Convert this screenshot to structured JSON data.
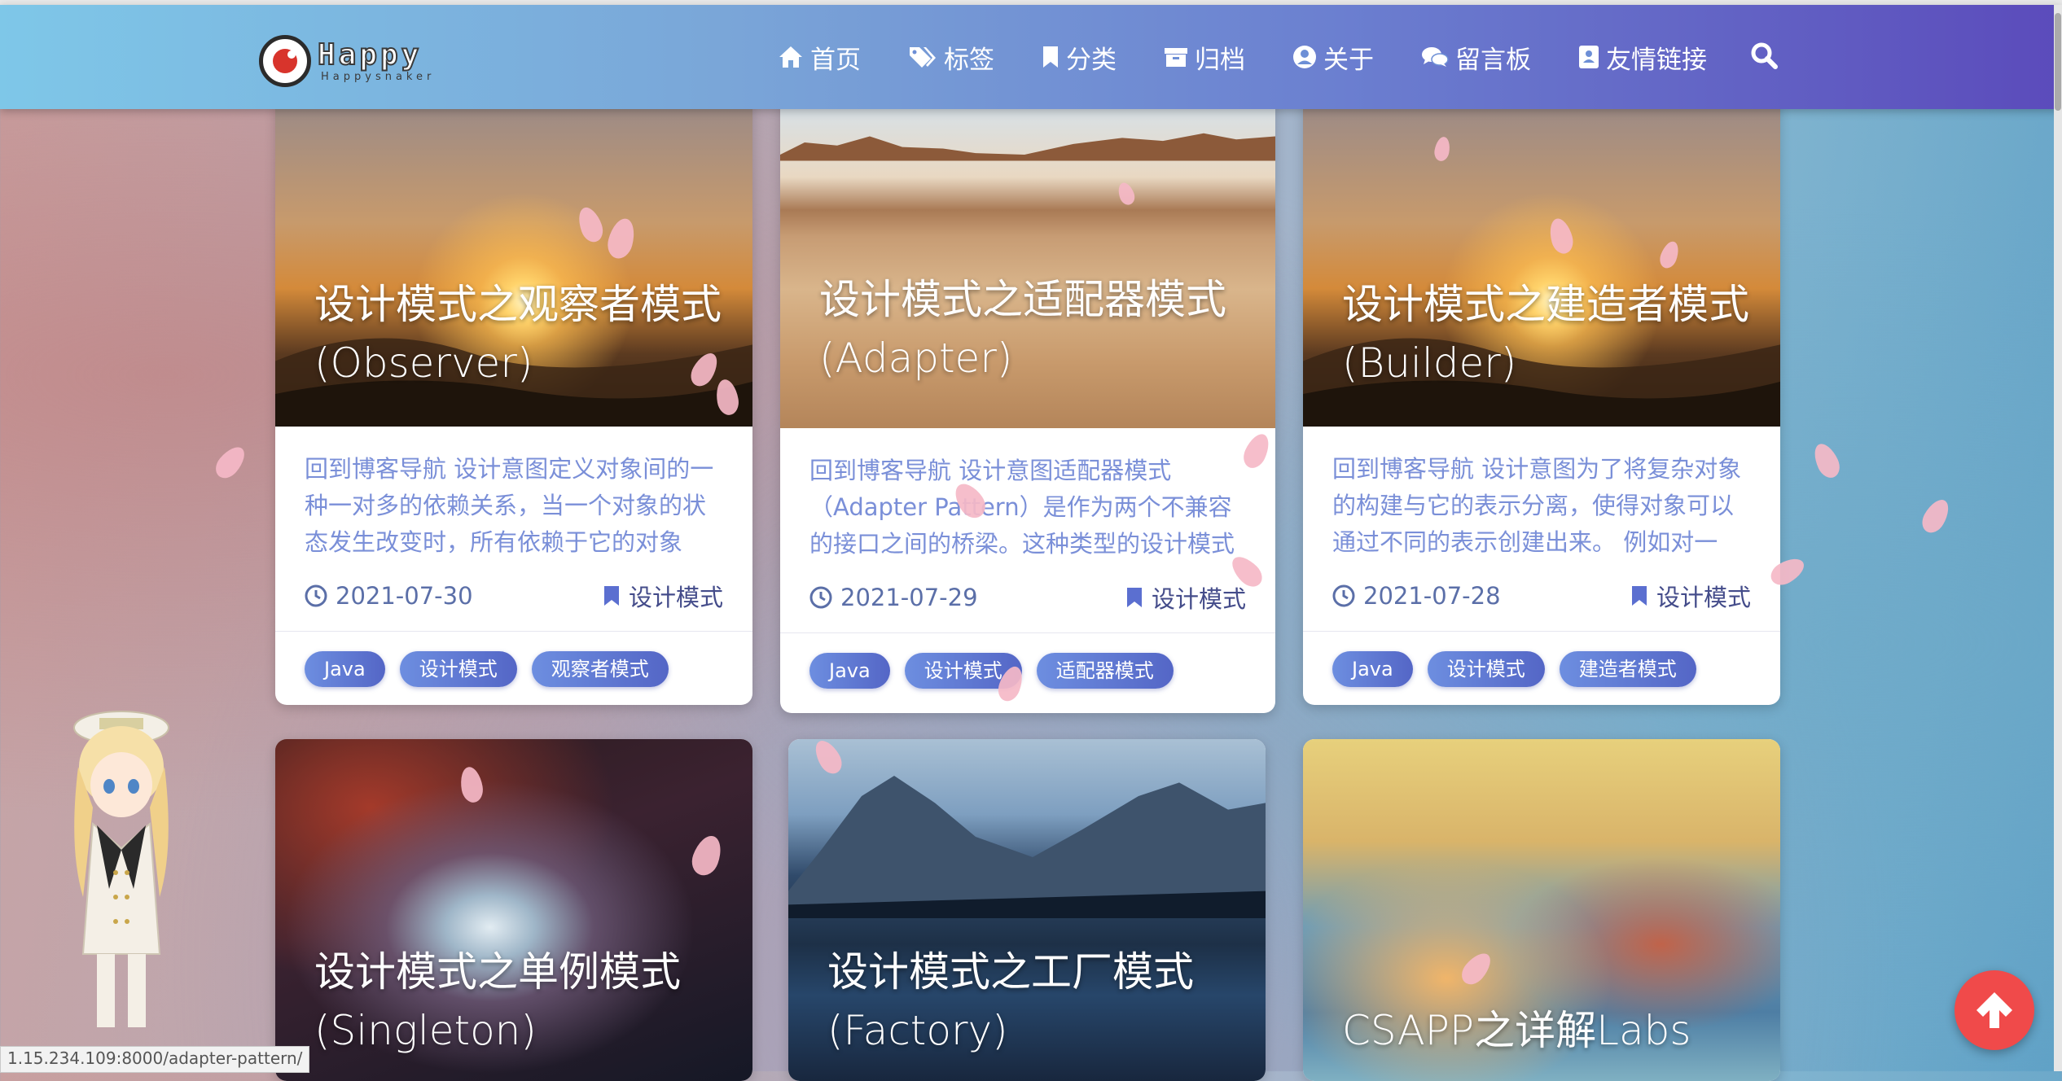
{
  "logo": {
    "main": "Happy",
    "sub": "Happysnaker"
  },
  "nav": [
    {
      "label": "首页",
      "icon": "home-icon"
    },
    {
      "label": "标签",
      "icon": "tags-icon"
    },
    {
      "label": "分类",
      "icon": "bookmark-icon"
    },
    {
      "label": "归档",
      "icon": "archive-icon"
    },
    {
      "label": "关于",
      "icon": "user-circle-icon"
    },
    {
      "label": "留言板",
      "icon": "comments-icon"
    },
    {
      "label": "友情链接",
      "icon": "address-card-icon"
    }
  ],
  "posts": [
    {
      "title": "设计模式之观察者模式",
      "subtitle": "(Observer)",
      "desc": "回到博客导航 设计意图定义对象间的一种一对多的依赖关系，当一个对象的状态发生改变时，所有依赖于它的对象都...",
      "date": "2021-07-30",
      "category": "设计模式",
      "tags": [
        "Java",
        "设计模式",
        "观察者模式"
      ]
    },
    {
      "title": "设计模式之适配器模式",
      "subtitle": "(Adapter)",
      "desc": "回到博客导航 设计意图适配器模式（Adapter Pattern）是作为两个不兼容的接口之间的桥梁。这种类型的设计模式属...",
      "date": "2021-07-29",
      "category": "设计模式",
      "tags": [
        "Java",
        "设计模式",
        "适配器模式"
      ]
    },
    {
      "title": "设计模式之建造者模式",
      "subtitle": "(Builder)",
      "desc": "回到博客导航 设计意图为了将复杂对象的构建与它的表示分离，使得对象可以通过不同的表示创建出来。 例如对一个...",
      "date": "2021-07-28",
      "category": "设计模式",
      "tags": [
        "Java",
        "设计模式",
        "建造者模式"
      ]
    },
    {
      "title": "设计模式之单例模式",
      "subtitle": "(Singleton)"
    },
    {
      "title": "设计模式之工厂模式",
      "subtitle": "(Factory)"
    },
    {
      "title": "CSAPP之详解Labs",
      "subtitle": ""
    }
  ],
  "status_url": "1.15.234.109:8000/adapter-pattern/",
  "colors": {
    "accent": "#5b6fd0",
    "tag_start": "#6d8ee0",
    "tag_end": "#5466c6",
    "scroll_top": "#f04a4a"
  }
}
